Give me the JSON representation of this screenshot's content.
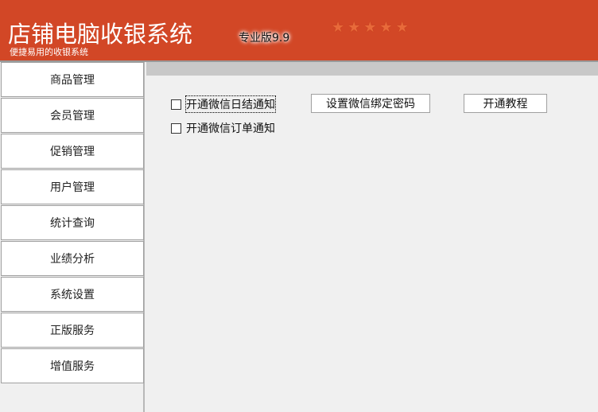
{
  "header": {
    "title": "店铺电脑收银系统",
    "edition": "专业版9.9",
    "subtitle": "便捷易用的收银系统",
    "stars": [
      "★",
      "★",
      "★",
      "★",
      "★"
    ],
    "background_color": "#d24726"
  },
  "sidebar": {
    "items": [
      {
        "label": "商品管理"
      },
      {
        "label": "会员管理"
      },
      {
        "label": "促销管理"
      },
      {
        "label": "用户管理"
      },
      {
        "label": "统计查询"
      },
      {
        "label": "业绩分析"
      },
      {
        "label": "系统设置"
      },
      {
        "label": "正版服务"
      },
      {
        "label": "增值服务"
      }
    ]
  },
  "main": {
    "daily_summary_checkbox": {
      "label": "开通微信日结通知",
      "checked": false
    },
    "order_notify_checkbox": {
      "label": "开通微信订单通知",
      "checked": false
    },
    "set_password_button": "设置微信绑定密码",
    "tutorial_button": "开通教程"
  }
}
